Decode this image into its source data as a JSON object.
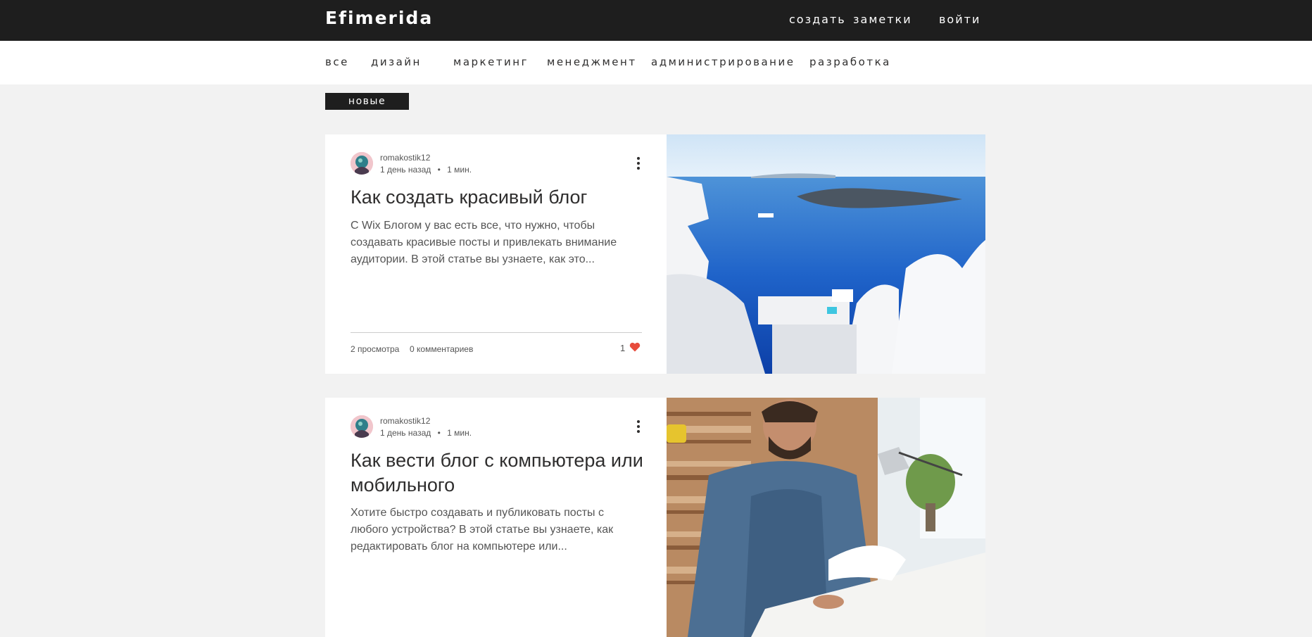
{
  "header": {
    "logo": "Efimerida",
    "nav": {
      "create": "создать",
      "notes": "заметки",
      "login": "войти"
    }
  },
  "categories": [
    "все",
    "дизайн",
    "маркетинг",
    "менеджмент",
    "администрирование",
    "разработка"
  ],
  "sort_label": "новые",
  "posts": [
    {
      "author": "romakostik12",
      "date": "1 день назад",
      "separator": "•",
      "read_time": "1 мин.",
      "title": "Как создать красивый блог",
      "excerpt": "С Wix Блогом у вас есть все, что нужно, чтобы создавать красивые посты и привлекать внимание аудитории. В этой статье вы узнаете, как это...",
      "views": "2 просмотра",
      "comments": "0 комментариев",
      "likes": "1"
    },
    {
      "author": "romakostik12",
      "date": "1 день назад",
      "separator": "•",
      "read_time": "1 мин.",
      "title": "Как вести блог с компьютера или мобильного",
      "excerpt": "Хотите быстро создавать и публиковать посты с любого устройства? В этой статье вы узнаете, как редактировать блог на компьютере или..."
    }
  ],
  "colors": {
    "header_bg": "#1e1e1e",
    "page_bg": "#f2f2f2",
    "like_heart": "#e74c3c"
  }
}
